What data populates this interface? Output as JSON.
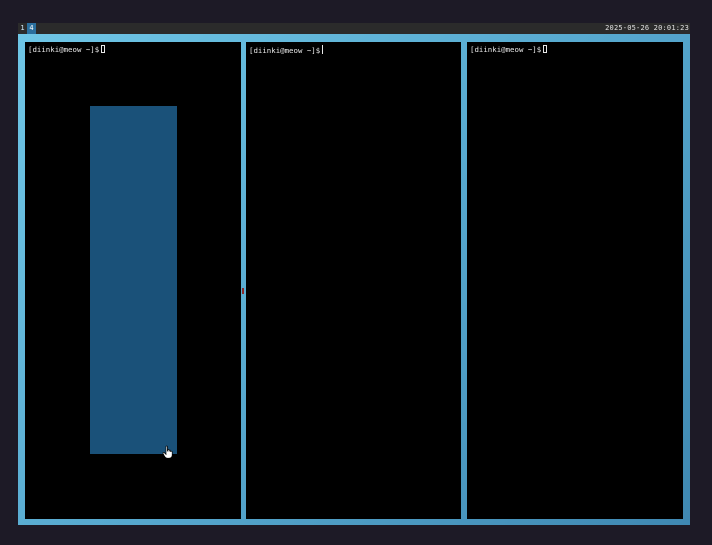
{
  "statusbar": {
    "workspaces": [
      {
        "label": "1",
        "active": false
      },
      {
        "label": "4",
        "active": true
      }
    ],
    "clock": "2025-05-26 20:01:23"
  },
  "panes": [
    {
      "prompt": "[diinki@meow ~]$",
      "cursor": "block"
    },
    {
      "prompt": "[diinki@meow ~]$",
      "cursor": "bar"
    },
    {
      "prompt": "[diinki@meow ~]$",
      "cursor": "block"
    }
  ],
  "colors": {
    "border_gradient": [
      "#6fc6e6",
      "#3f88b2"
    ],
    "selection": "#1a5179",
    "active_workspace": "#2a6f9e",
    "background": "#1d1a26"
  }
}
